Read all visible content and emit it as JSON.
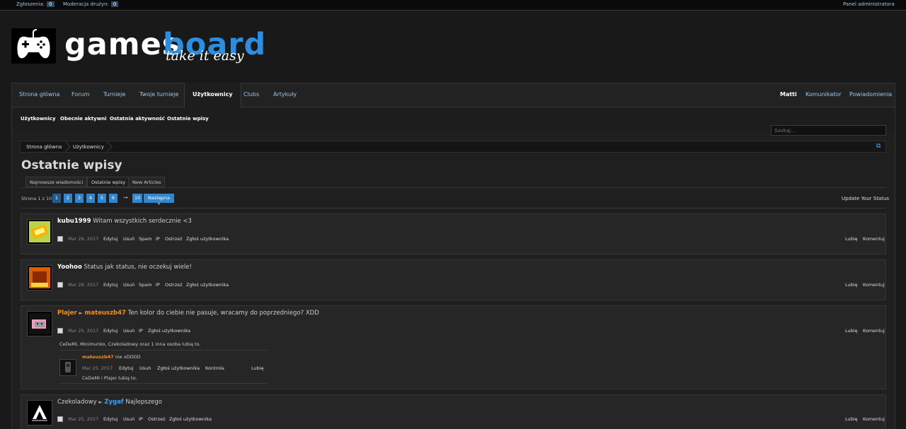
{
  "adminbar": {
    "reports_label": "Zgłoszenia:",
    "reports_count": "0",
    "moderation_label": "Moderacja drużyn:",
    "moderation_count": "0",
    "admin_panel": "Panel administratora"
  },
  "logo": {
    "part1": "games",
    "part2": "board",
    "tagline": "take it easy"
  },
  "nav": {
    "tabs": [
      "Strona główna",
      "Forum",
      "Turnieje",
      "Twoje turnieje",
      "Użytkownicy",
      "Clubs",
      "Artykuły"
    ],
    "right": {
      "user": "Matti",
      "messenger": "Komunikator",
      "notifications": "Powiadomienia"
    }
  },
  "subnav": [
    "Użytkownicy",
    "Obecnie aktywni",
    "Ostatnia aktywność",
    "Ostatnie wpisy"
  ],
  "search": {
    "placeholder": "Szukaj..."
  },
  "breadcrumb": [
    "Strona główna",
    "Użytkownicy"
  ],
  "page_title": "Ostatnie wpisy",
  "page_tabs": [
    "Najnowsze wiadomości",
    "Ostatnie wpisy",
    "New Articles"
  ],
  "pager": {
    "label": "Strona 1 z 10",
    "pages": [
      "1",
      "2",
      "3",
      "4",
      "5",
      "6"
    ],
    "ellipsis": "→",
    "last": "10",
    "next": "Następna »"
  },
  "update_status": "Update Your Status",
  "actions": {
    "edit": "Edytuj",
    "delete": "Usuń",
    "spam": "Spam",
    "ip": "IP",
    "warn": "Ostrzeż",
    "report": "Zgłoś użytkownika",
    "like": "Lubię",
    "comment": "Komentuj",
    "control": "Kontrola"
  },
  "posts": [
    {
      "user": "kubu1999",
      "text": "Witam wszystkich serdecznie <3",
      "date": "Mar 29, 2017"
    },
    {
      "user": "Yoohoo",
      "text": "Status jak status, nie oczekuj wiele!",
      "date": "Mar 28, 2017"
    },
    {
      "user": "Plajer",
      "arrow": "►",
      "target": "mateuszb47",
      "text": "Ten kolor do ciebie nie pasuje, wracamy do poprzedniego? XDD",
      "date": "Mar 25, 2017",
      "likes": "CeDeMi, Minimunko, Czekoladowy oraz 1 inna osoba lubią to.",
      "comment": {
        "user": "mateuszb47",
        "text": "nie xDDDD",
        "date": "Mar 25, 2017",
        "likes": "CeDeMi i Plajer lubią to."
      }
    },
    {
      "user": "Czekoladowy",
      "arrow": "►",
      "target": "Zygaf",
      "text": "Najlepszego",
      "date": "Mar 25, 2017"
    }
  ],
  "colors": {
    "accent": "#2f87d1",
    "link": "#9bc7ea",
    "orange_user": "#ff8c00",
    "blue_user": "#3ba0ef"
  }
}
